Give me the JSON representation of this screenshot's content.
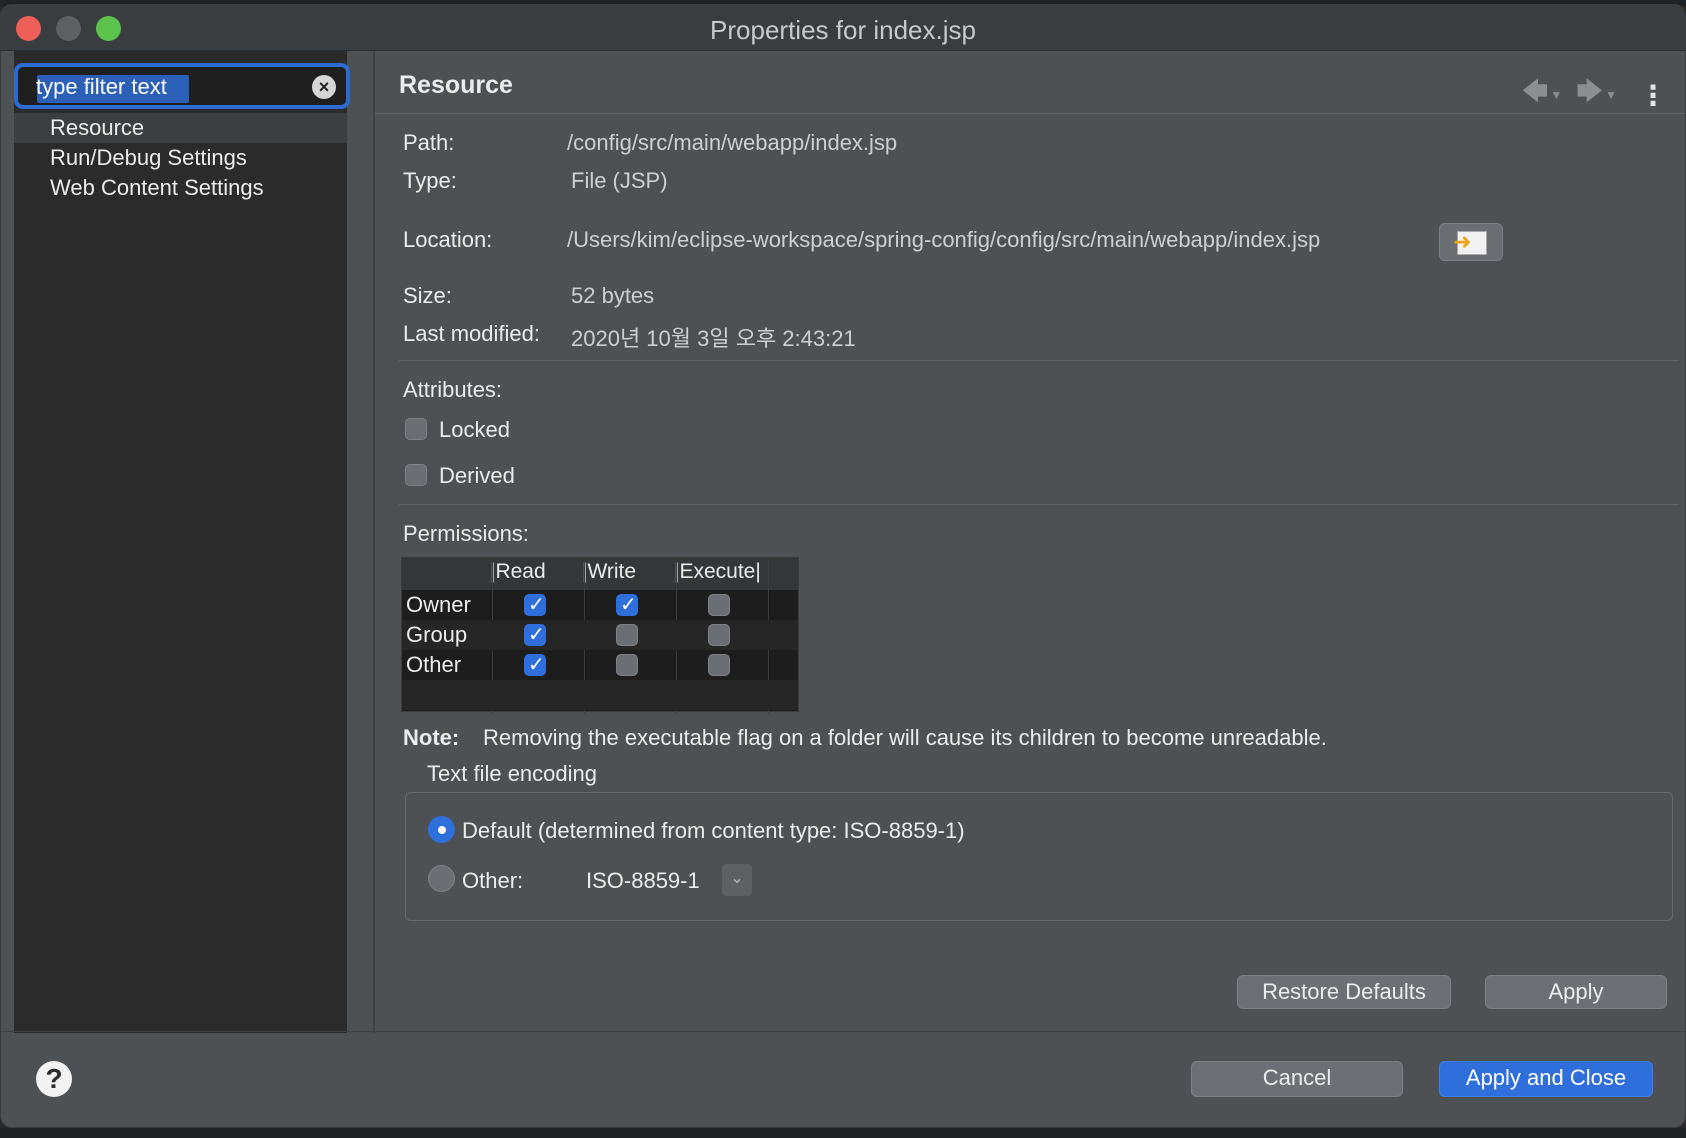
{
  "window": {
    "title": "Properties for index.jsp"
  },
  "sidebar": {
    "filter_placeholder": "type filter text",
    "items": [
      {
        "label": "Resource",
        "selected": true
      },
      {
        "label": "Run/Debug Settings",
        "selected": false
      },
      {
        "label": "Web Content Settings",
        "selected": false
      }
    ]
  },
  "page": {
    "title": "Resource",
    "path_label": "Path:",
    "path_value": "/config/src/main/webapp/index.jsp",
    "type_label": "Type:",
    "type_value": "File  (JSP)",
    "location_label": "Location:",
    "location_value": "/Users/kim/eclipse-workspace/spring-config/config/src/main/webapp/index.jsp",
    "size_label": "Size:",
    "size_value": "52  bytes",
    "modified_label": "Last modified:",
    "modified_value": "2020년 10월 3일 오후 2:43:21",
    "attributes_label": "Attributes:",
    "locked_label": "Locked",
    "derived_label": "Derived",
    "permissions_label": "Permissions:",
    "perm_headers": [
      "|Read",
      "|Write",
      "|Execute|"
    ],
    "perm_rows": [
      {
        "label": "Owner",
        "read": true,
        "write": true,
        "execute": false
      },
      {
        "label": "Group",
        "read": true,
        "write": false,
        "execute": false
      },
      {
        "label": "Other",
        "read": true,
        "write": false,
        "execute": false
      }
    ],
    "note_bold": "Note:",
    "note_text": "Removing the executable flag on a folder will cause its children to become unreadable.",
    "encoding_title": "Text file encoding",
    "encoding_default": "Default (determined from content type: ISO-8859-1)",
    "encoding_other_label": "Other:",
    "encoding_other_value": "ISO-8859-1",
    "restore_defaults": "Restore Defaults",
    "apply": "Apply"
  },
  "footer": {
    "help": "?",
    "cancel": "Cancel",
    "apply_and_close": "Apply and Close"
  },
  "colors": {
    "accent": "#2f6fdb",
    "window_bg": "#4d5154",
    "sidebar_bg": "#2b2b2b"
  }
}
